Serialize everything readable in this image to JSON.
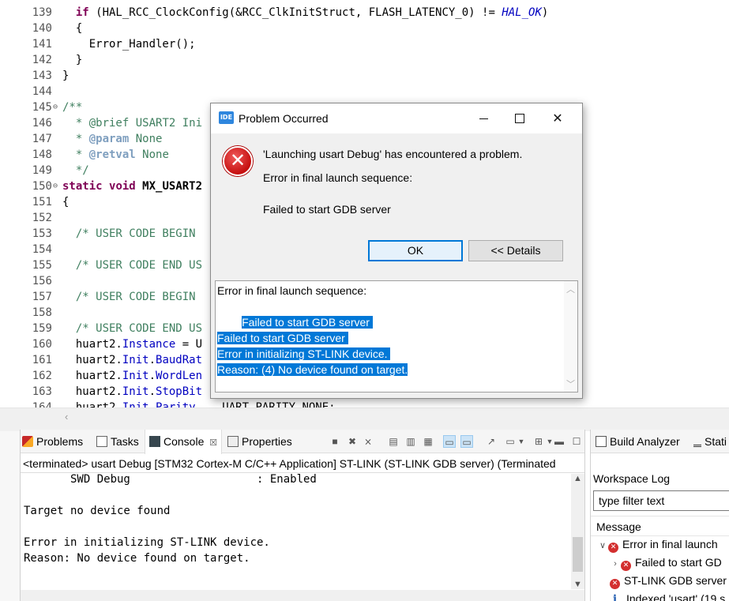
{
  "editor": {
    "lines": [
      {
        "num": "139",
        "fold": "",
        "parts": [
          {
            "t": "  "
          },
          {
            "t": "if",
            "c": "kw"
          },
          {
            "t": " (HAL_RCC_ClockConfig(&RCC_ClkInitStruct, FLASH_LATENCY_0) != "
          },
          {
            "t": "HAL_OK",
            "c": "ital"
          },
          {
            "t": ")"
          }
        ]
      },
      {
        "num": "140",
        "fold": "",
        "parts": [
          {
            "t": "  {"
          }
        ]
      },
      {
        "num": "141",
        "fold": "",
        "parts": [
          {
            "t": "    Error_Handler();"
          }
        ]
      },
      {
        "num": "142",
        "fold": "",
        "parts": [
          {
            "t": "  }"
          }
        ]
      },
      {
        "num": "143",
        "fold": "",
        "parts": [
          {
            "t": "}"
          }
        ]
      },
      {
        "num": "144",
        "fold": "",
        "parts": []
      },
      {
        "num": "145",
        "fold": "⊖",
        "parts": [
          {
            "t": "/**",
            "c": "cm"
          }
        ]
      },
      {
        "num": "146",
        "fold": "",
        "parts": [
          {
            "t": "  * ",
            "c": "cm"
          },
          {
            "t": "@brief",
            "c": "cm"
          },
          {
            "t": " USART2 Ini",
            "c": "cm"
          }
        ]
      },
      {
        "num": "147",
        "fold": "",
        "parts": [
          {
            "t": "  * ",
            "c": "cm"
          },
          {
            "t": "@param",
            "c": "tag"
          },
          {
            "t": " None",
            "c": "cm"
          }
        ]
      },
      {
        "num": "148",
        "fold": "",
        "parts": [
          {
            "t": "  * ",
            "c": "cm"
          },
          {
            "t": "@retval",
            "c": "tag"
          },
          {
            "t": " None",
            "c": "cm"
          }
        ]
      },
      {
        "num": "149",
        "fold": "",
        "parts": [
          {
            "t": "  */",
            "c": "cm"
          }
        ]
      },
      {
        "num": "150",
        "fold": "⊖",
        "parts": [
          {
            "t": "static",
            "c": "kw"
          },
          {
            "t": " "
          },
          {
            "t": "void",
            "c": "kw"
          },
          {
            "t": " "
          },
          {
            "t": "MX_USART2",
            "c": "bold"
          }
        ]
      },
      {
        "num": "151",
        "fold": "",
        "parts": [
          {
            "t": "{"
          }
        ]
      },
      {
        "num": "152",
        "fold": "",
        "parts": []
      },
      {
        "num": "153",
        "fold": "",
        "parts": [
          {
            "t": "  /* USER CODE BEGIN ",
            "c": "cm"
          }
        ]
      },
      {
        "num": "154",
        "fold": "",
        "parts": []
      },
      {
        "num": "155",
        "fold": "",
        "parts": [
          {
            "t": "  /* USER CODE END US",
            "c": "cm"
          }
        ]
      },
      {
        "num": "156",
        "fold": "",
        "parts": []
      },
      {
        "num": "157",
        "fold": "",
        "parts": [
          {
            "t": "  /* USER CODE BEGIN ",
            "c": "cm"
          }
        ]
      },
      {
        "num": "158",
        "fold": "",
        "parts": []
      },
      {
        "num": "159",
        "fold": "",
        "parts": [
          {
            "t": "  /* USER CODE END US",
            "c": "cm"
          }
        ]
      },
      {
        "num": "160",
        "fold": "",
        "parts": [
          {
            "t": "  huart2."
          },
          {
            "t": "Instance",
            "c": "fld"
          },
          {
            "t": " = U"
          }
        ]
      },
      {
        "num": "161",
        "fold": "",
        "parts": [
          {
            "t": "  huart2."
          },
          {
            "t": "Init",
            "c": "fld"
          },
          {
            "t": "."
          },
          {
            "t": "BaudRat",
            "c": "fld"
          }
        ]
      },
      {
        "num": "162",
        "fold": "",
        "parts": [
          {
            "t": "  huart2."
          },
          {
            "t": "Init",
            "c": "fld"
          },
          {
            "t": "."
          },
          {
            "t": "WordLen",
            "c": "fld"
          }
        ]
      },
      {
        "num": "163",
        "fold": "",
        "parts": [
          {
            "t": "  huart2."
          },
          {
            "t": "Init",
            "c": "fld"
          },
          {
            "t": "."
          },
          {
            "t": "StopBit",
            "c": "fld"
          }
        ]
      },
      {
        "num": "164",
        "fold": "",
        "parts": [
          {
            "t": "  huart2."
          },
          {
            "t": "Init",
            "c": "fld"
          },
          {
            "t": "."
          },
          {
            "t": "Parity",
            "c": "fld"
          },
          {
            "t": "    UART_PARITY_NONE;"
          }
        ]
      }
    ]
  },
  "dialog": {
    "app_icon": "IDE",
    "title": "Problem Occurred",
    "message": "'Launching usart Debug' has encountered a problem.",
    "line1": "Error in final launch sequence:",
    "line2": "Failed to start GDB server",
    "ok_label": "OK",
    "details_label": "<< Details",
    "details_lines": [
      {
        "text": "Error in final launch sequence:",
        "selected": false,
        "indent": ""
      },
      {
        "text": "",
        "selected": false,
        "indent": ""
      },
      {
        "text": "Failed to start GDB server ",
        "selected": true,
        "indent": "        "
      },
      {
        "text": "Failed to start GDB server ",
        "selected": true,
        "indent": ""
      },
      {
        "text": "Error in initializing ST-LINK device. ",
        "selected": true,
        "indent": ""
      },
      {
        "text": "Reason: (4) No device found on target.",
        "selected": true,
        "indent": ""
      }
    ]
  },
  "console": {
    "tabs": [
      {
        "label": "Problems",
        "icon": "problems-icon"
      },
      {
        "label": "Tasks",
        "icon": "tasks-icon"
      },
      {
        "label": "Console",
        "icon": "console-icon",
        "close": "☒"
      },
      {
        "label": "Properties",
        "icon": "properties-icon"
      }
    ],
    "header": "<terminated> usart Debug [STM32 Cortex-M C/C++ Application] ST-LINK (ST-LINK GDB server) (Terminated",
    "lines": [
      "       SWD Debug                   : Enabled",
      "",
      "Target no device found",
      "",
      "Error in initializing ST-LINK device.",
      "Reason: No device found on target."
    ]
  },
  "right_panel": {
    "tabs": [
      {
        "label": "Build Analyzer",
        "icon": "build-analyzer-icon"
      },
      {
        "label": "Stati",
        "icon": "static-stack-icon"
      }
    ],
    "title": "Workspace Log",
    "filter_placeholder": "type filter text",
    "column": "Message",
    "rows": [
      {
        "chev": "∨",
        "type": "error",
        "text": "Error in final launch"
      },
      {
        "chev": "›",
        "type": "error",
        "text": "Failed to start GD"
      },
      {
        "chev": "",
        "type": "error",
        "text": "ST-LINK GDB server"
      },
      {
        "chev": "",
        "type": "info",
        "text": "Indexed 'usart' (19 s"
      }
    ]
  }
}
